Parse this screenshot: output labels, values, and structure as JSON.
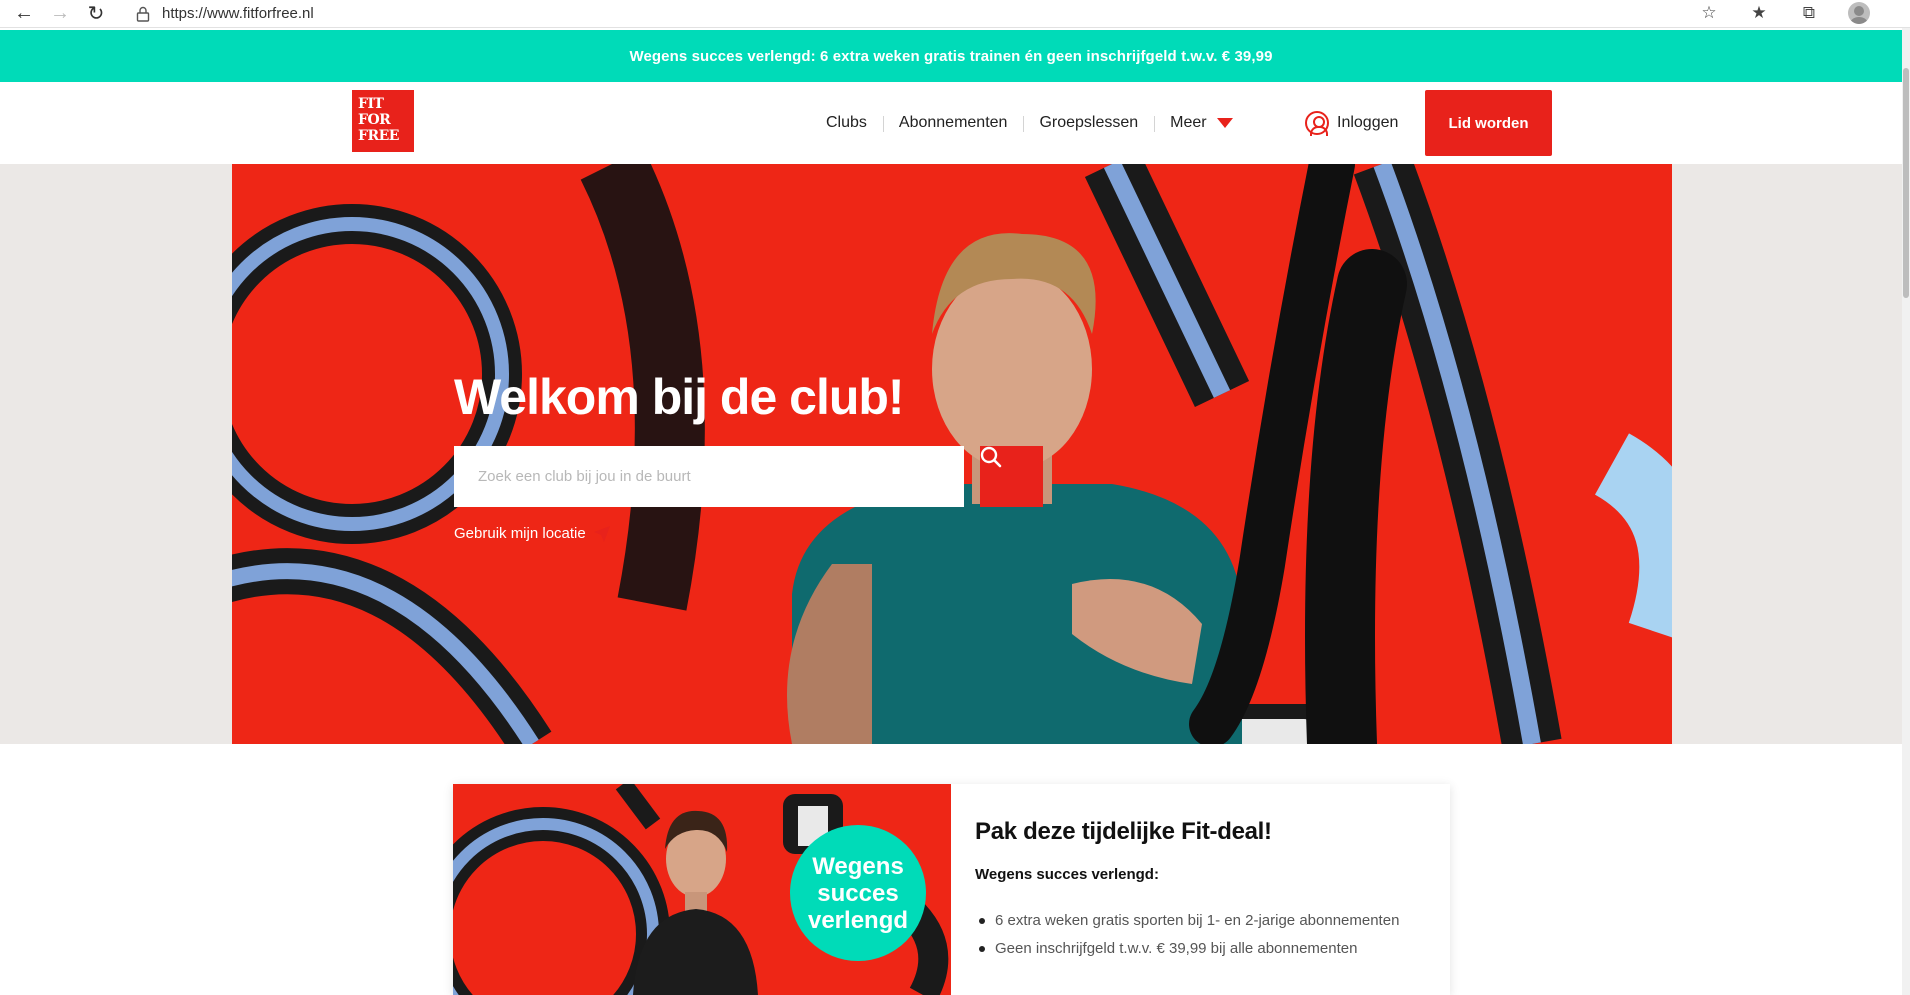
{
  "browser": {
    "url": "https://www.fitforfree.nl"
  },
  "promo": {
    "text": "Wegens succes verlengd: 6 extra weken gratis trainen én geen inschrijfgeld t.w.v. € 39,99"
  },
  "header": {
    "logo": [
      "FIT",
      "FOR",
      "FREE"
    ],
    "nav": [
      {
        "label": "Clubs"
      },
      {
        "label": "Abonnementen"
      },
      {
        "label": "Groepslessen"
      },
      {
        "label": "Meer"
      }
    ],
    "login_label": "Inloggen",
    "cta_label": "Lid worden"
  },
  "hero": {
    "title": "Welkom bij de club!",
    "search_placeholder": "Zoek een club bij jou in de buurt",
    "location_label": "Gebruik mijn locatie"
  },
  "deal": {
    "badge": [
      "Wegens",
      "succes",
      "verlengd"
    ],
    "title": "Pak deze tijdelijke Fit-deal!",
    "subtitle": "Wegens succes verlengd:",
    "items": [
      "6 extra weken gratis sporten bij 1- en 2-jarige abonnementen",
      "Geen inschrijfgeld t.w.v. € 39,99 bij alle abonnementen"
    ]
  },
  "colors": {
    "brand_red": "#e8221b",
    "promo_teal": "#00dbb8"
  }
}
